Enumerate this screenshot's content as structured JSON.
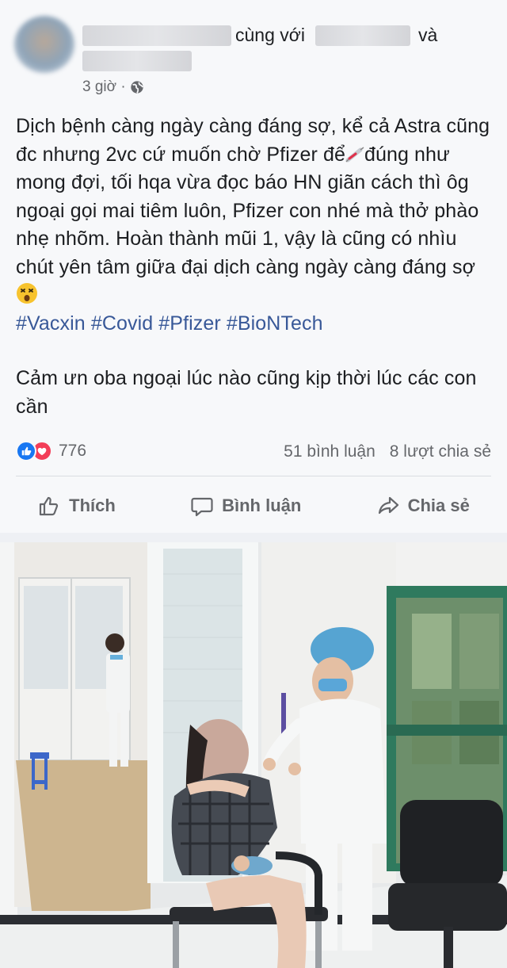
{
  "post": {
    "author_connector": "cùng với",
    "author_and": "và",
    "time": "3 giờ ·",
    "privacy_icon": "globe-icon",
    "body_lines": {
      "p1_a": "Dịch bệnh càng ngày càng đáng sợ, kể cả Astra cũng đc nhưng 2vc cứ muốn chờ Pfizer để",
      "p1_b": "đúng như mong đợi, tối hqa vừa đọc báo HN giãn cách thì ôg ngoại gọi mai tiêm luôn, Pfizer con nhé mà thở phào nhẹ nhõm. Hoàn thành mũi 1, vậy là cũng có nhìu chút yên tâm giữa đại dịch càng ngày càng đáng sợ"
    },
    "hashtags": "#Vacxin #Covid #Pfizer #BioNTech",
    "closing": "Cảm ưn oba ngoại lúc nào cũng kịp thời lúc các con cần"
  },
  "stats": {
    "reaction_count": "776",
    "comments": "51 bình luận",
    "shares": "8 lượt chia sẻ"
  },
  "actions": {
    "like": "Thích",
    "comment": "Bình luận",
    "share": "Chia sẻ"
  },
  "colors": {
    "link": "#385898",
    "like_blue": "#1877f2",
    "love_red": "#f33e58",
    "muted": "#65676b"
  }
}
